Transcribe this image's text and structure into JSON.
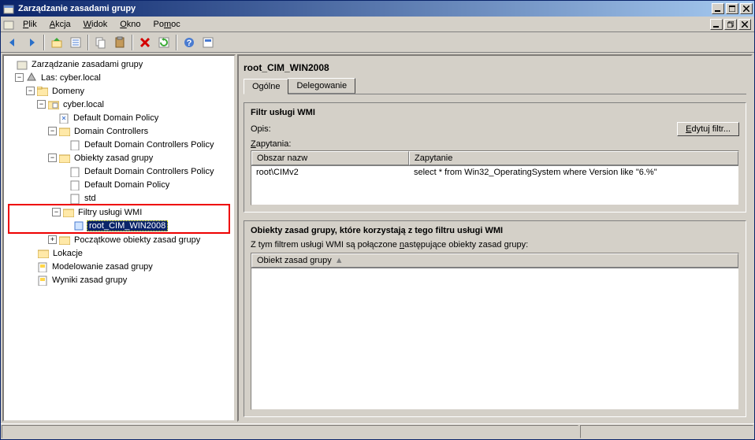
{
  "window": {
    "title": "Zarządzanie zasadami grupy"
  },
  "menu": {
    "plik": "Plik",
    "akcja": "Akcja",
    "widok": "Widok",
    "okno": "Okno",
    "pomoc": "Pomoc"
  },
  "tree": {
    "root": "Zarządzanie zasadami grupy",
    "forest": "Las: cyber.local",
    "domains": "Domeny",
    "domain": "cyber.local",
    "ddp": "Default Domain Policy",
    "dc": "Domain Controllers",
    "ddcp": "Default Domain Controllers Policy",
    "gpo": "Obiekty zasad grupy",
    "gpo_ddcp": "Default Domain Controllers Policy",
    "gpo_ddp": "Default Domain Policy",
    "gpo_std": "std",
    "wmi": "Filtry usługi WMI",
    "wmi_item": "root_CIM_WIN2008",
    "starter": "Początkowe obiekty zasad grupy",
    "sites": "Lokacje",
    "modeling": "Modelowanie zasad grupy",
    "results": "Wyniki zasad grupy"
  },
  "detail": {
    "title": "root_CIM_WIN2008",
    "tab_general": "Ogólne",
    "tab_delegation": "Delegowanie",
    "filter_section": "Filtr usługi WMI",
    "desc_label": "Opis:",
    "edit_btn": "Edytuj filtr...",
    "queries_label": "Zapytania:",
    "col_namespace": "Obszar nazw",
    "col_query": "Zapytanie",
    "row_ns": "root\\CIMv2",
    "row_q": "select * from Win32_OperatingSystem where Version like \"6.%\"",
    "gpo_section": "Obiekty zasad grupy, które korzystają z tego filtru usługi WMI",
    "gpo_text": "Z tym filtrem usługi WMI są połączone następujące obiekty zasad grupy:",
    "gpo_col": "Obiekt zasad grupy"
  }
}
